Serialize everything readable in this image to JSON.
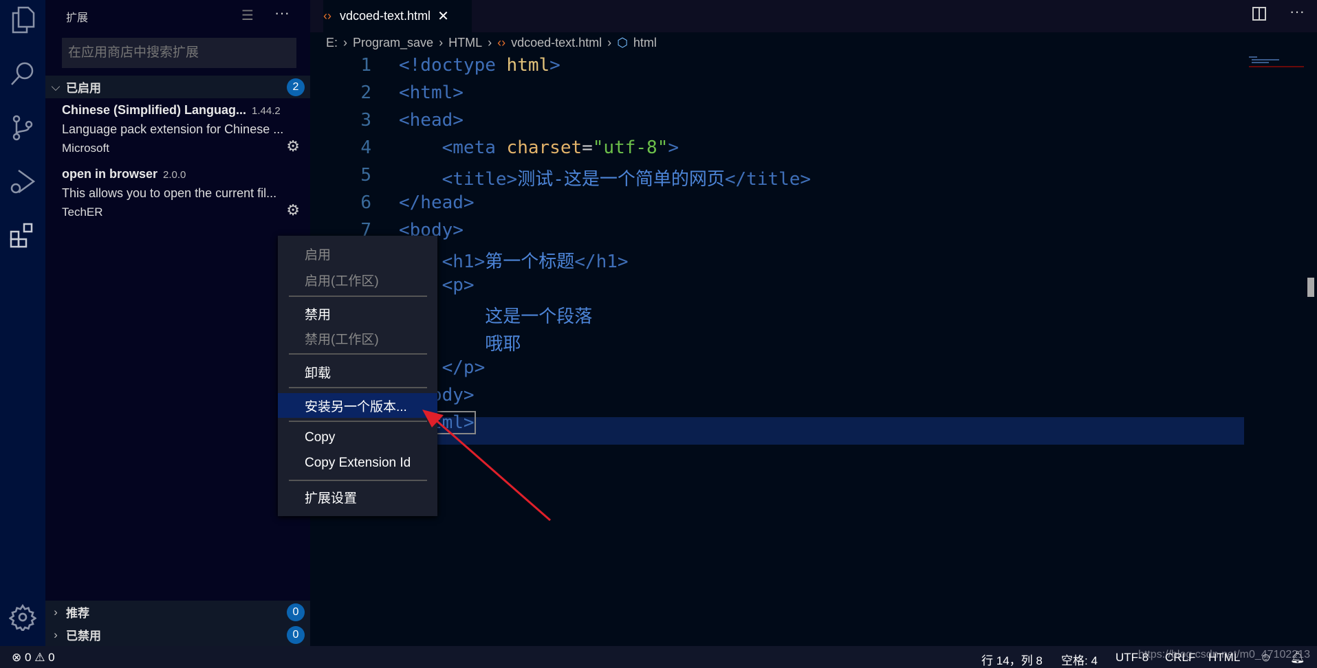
{
  "activity_bar": {
    "icons": [
      "files-icon",
      "search-icon",
      "source-control-icon",
      "run-debug-icon",
      "extensions-icon",
      "settings-gear-icon"
    ]
  },
  "sidebar": {
    "title": "扩展",
    "search_placeholder": "在应用商店中搜索扩展",
    "enabled_section": {
      "label": "已启用",
      "count": "2"
    },
    "extensions": [
      {
        "name": "Chinese (Simplified) Languag...",
        "version": "1.44.2",
        "description": "Language pack extension for Chinese ...",
        "publisher": "Microsoft"
      },
      {
        "name": "open in browser",
        "version": "2.0.0",
        "description": "This allows you to open the current fil...",
        "publisher": "TechER"
      }
    ],
    "recommended_section": {
      "label": "推荐",
      "count": "0"
    },
    "disabled_section": {
      "label": "已禁用",
      "count": "0"
    }
  },
  "editor": {
    "tab": {
      "label": "vdcoed-text.html"
    },
    "breadcrumb": [
      "E:",
      "Program_save",
      "HTML",
      "vdcoed-text.html",
      "html"
    ],
    "lines": [
      [
        [
          "tag",
          "<!doctype "
        ],
        [
          "kw",
          "html"
        ],
        [
          "tag",
          ">"
        ]
      ],
      [
        [
          "tag",
          "<html>"
        ]
      ],
      [
        [
          "tag",
          "<head>"
        ]
      ],
      [
        [
          "eq",
          "    "
        ],
        [
          "tag",
          "<meta "
        ],
        [
          "attr",
          "charset"
        ],
        [
          "eq",
          "="
        ],
        [
          "str",
          "\"utf-8\""
        ],
        [
          "tag",
          ">"
        ]
      ],
      [
        [
          "eq",
          "    "
        ],
        [
          "tag",
          "<title>"
        ],
        [
          "txt",
          "测试-这是一个简单的网页"
        ],
        [
          "tag",
          "</title>"
        ]
      ],
      [
        [
          "tag",
          "</head>"
        ]
      ],
      [
        [
          "tag",
          "<body>"
        ]
      ],
      [
        [
          "eq",
          "    "
        ],
        [
          "tag",
          "<h1>"
        ],
        [
          "txt",
          "第一个标题"
        ],
        [
          "tag",
          "</h1>"
        ]
      ],
      [
        [
          "eq",
          "    "
        ],
        [
          "tag",
          "<p>"
        ]
      ],
      [
        [
          "eq",
          "        "
        ],
        [
          "txt",
          "这是一个段落"
        ]
      ],
      [
        [
          "eq",
          "        "
        ],
        [
          "txt",
          "哦耶"
        ]
      ],
      [
        [
          "eq",
          "    "
        ],
        [
          "tag",
          "</p>"
        ]
      ],
      [
        [
          "tag",
          "</body>"
        ]
      ],
      [
        [
          "tag",
          "</html>"
        ]
      ]
    ]
  },
  "context_menu": {
    "items": [
      {
        "label": "启用",
        "disabled": true
      },
      {
        "label": "启用(工作区)",
        "disabled": true
      },
      {
        "label": "禁用",
        "disabled": false
      },
      {
        "label": "禁用(工作区)",
        "disabled": true
      },
      {
        "label": "卸载",
        "disabled": false
      },
      {
        "label": "安装另一个版本...",
        "disabled": false,
        "highlighted": true
      },
      {
        "label": "Copy",
        "disabled": false
      },
      {
        "label": "Copy Extension Id",
        "disabled": false
      },
      {
        "label": "扩展设置",
        "disabled": false
      }
    ]
  },
  "status_bar": {
    "errors": "0",
    "warnings": "0",
    "position": "行 14，列 8",
    "spaces": "空格: 4",
    "encoding": "UTF-8",
    "eol": "CRLF",
    "language": "HTML"
  },
  "watermark": "https://blog.csdn.net/m0_47102213",
  "colors": {
    "accent_badge": "#0b64b0",
    "menu_highlight": "#0a2463",
    "annotation_arrow": "#e0202a"
  }
}
